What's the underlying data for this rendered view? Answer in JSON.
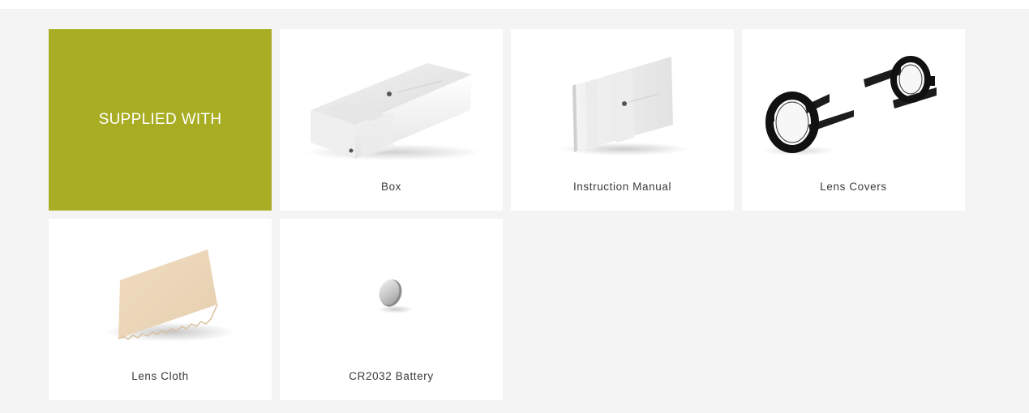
{
  "section": {
    "heading": "SUPPLIED WITH",
    "accent_color": "#a8ad23"
  },
  "items": [
    {
      "label": "Box",
      "icon": "box-image"
    },
    {
      "label": "Instruction Manual",
      "icon": "manual-image"
    },
    {
      "label": "Lens Covers",
      "icon": "lens-covers-image"
    },
    {
      "label": "Lens Cloth",
      "icon": "lens-cloth-image"
    },
    {
      "label": "CR2032 Battery",
      "icon": "battery-image"
    }
  ]
}
